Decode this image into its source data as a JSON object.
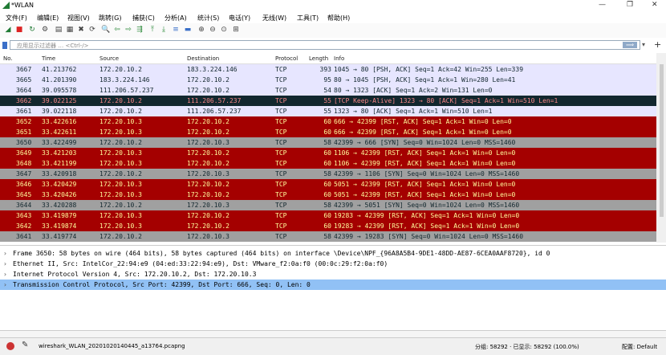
{
  "window": {
    "title": "*WLAN",
    "minimize": "—",
    "restore": "❐",
    "close": "✕"
  },
  "menu": [
    "文件(F)",
    "编辑(E)",
    "视图(V)",
    "跳转(G)",
    "捕获(C)",
    "分析(A)",
    "统计(S)",
    "电话(Y)",
    "无线(W)",
    "工具(T)",
    "帮助(H)"
  ],
  "toolbar": {
    "icons": [
      "shark-fin-icon",
      "stop-icon",
      "restart-icon",
      "options-icon",
      "open-icon",
      "save-icon",
      "close-file-icon",
      "reload-icon",
      "find-icon",
      "back-icon",
      "forward-icon",
      "goto-icon",
      "first-icon",
      "last-icon",
      "autoscroll-icon",
      "colorize-icon",
      "zoom-in-icon",
      "zoom-out-icon",
      "zoom-reset-icon",
      "resize-columns-icon"
    ],
    "glyphs": [
      "◢",
      "■",
      "↻",
      "⚙",
      "▤",
      "▦",
      "✖",
      "⟳",
      "🔍",
      "⇦",
      "⇨",
      "⇶",
      "⤒",
      "⤓",
      "≡",
      "▬",
      "⊕",
      "⊖",
      "⊙",
      "⊞"
    ]
  },
  "filter": {
    "placeholder": "应用显示过滤器 … <Ctrl-/>",
    "apply": "⟹",
    "dropdown": "▾",
    "add": "+"
  },
  "columns": [
    "No.",
    "Time",
    "Source",
    "Destination",
    "Protocol",
    "Length",
    "Info"
  ],
  "colors": {
    "selected_dark": "#12272e",
    "rst_red": "#a40000",
    "syn_gray": "#a0a0a0",
    "tcp_green": "#e7e6ff",
    "normal_purple": "#e7e6ff",
    "highlight_blue": "#91c1f5"
  },
  "packets": [
    {
      "no": "3667",
      "time": "41.213762",
      "src": "172.20.10.2",
      "dst": "183.3.224.146",
      "proto": "TCP",
      "len": "393",
      "info": "1045 → 80 [PSH, ACK] Seq=1 Ack=42 Win=255 Len=339",
      "style": "lavender"
    },
    {
      "no": "3665",
      "time": "41.201390",
      "src": "183.3.224.146",
      "dst": "172.20.10.2",
      "proto": "TCP",
      "len": "95",
      "info": "80 → 1045 [PSH, ACK] Seq=1 Ack=1 Win=280 Len=41",
      "style": "lavender"
    },
    {
      "no": "3664",
      "time": "39.095578",
      "src": "111.206.57.237",
      "dst": "172.20.10.2",
      "proto": "TCP",
      "len": "54",
      "info": "80 → 1323 [ACK] Seq=1 Ack=2 Win=131 Len=0",
      "style": "lavender"
    },
    {
      "no": "3662",
      "time": "39.022125",
      "src": "172.20.10.2",
      "dst": "111.206.57.237",
      "proto": "TCP",
      "len": "55",
      "info": "[TCP Keep-Alive] 1323 → 80 [ACK] Seq=1 Ack=1 Win=510 Len=1",
      "style": "dark"
    },
    {
      "no": "3661",
      "time": "39.022118",
      "src": "172.20.10.2",
      "dst": "111.206.57.237",
      "proto": "TCP",
      "len": "55",
      "info": "1323 → 80 [ACK] Seq=1 Ack=1 Win=510 Len=1",
      "style": "lavender"
    },
    {
      "no": "3652",
      "time": "33.422616",
      "src": "172.20.10.3",
      "dst": "172.20.10.2",
      "proto": "TCP",
      "len": "60",
      "info": "666 → 42399 [RST, ACK] Seq=1 Ack=1 Win=0 Len=0",
      "style": "red"
    },
    {
      "no": "3651",
      "time": "33.422611",
      "src": "172.20.10.3",
      "dst": "172.20.10.2",
      "proto": "TCP",
      "len": "60",
      "info": "666 → 42399 [RST, ACK] Seq=1 Ack=1 Win=0 Len=0",
      "style": "red"
    },
    {
      "no": "3650",
      "time": "33.422499",
      "src": "172.20.10.2",
      "dst": "172.20.10.3",
      "proto": "TCP",
      "len": "58",
      "info": "42399 → 666 [SYN] Seq=0 Win=1024 Len=0 MSS=1460",
      "style": "gray"
    },
    {
      "no": "3649",
      "time": "33.421203",
      "src": "172.20.10.3",
      "dst": "172.20.10.2",
      "proto": "TCP",
      "len": "60",
      "info": "1106 → 42399 [RST, ACK] Seq=1 Ack=1 Win=0 Len=0",
      "style": "red"
    },
    {
      "no": "3648",
      "time": "33.421199",
      "src": "172.20.10.3",
      "dst": "172.20.10.2",
      "proto": "TCP",
      "len": "60",
      "info": "1106 → 42399 [RST, ACK] Seq=1 Ack=1 Win=0 Len=0",
      "style": "red"
    },
    {
      "no": "3647",
      "time": "33.420918",
      "src": "172.20.10.2",
      "dst": "172.20.10.3",
      "proto": "TCP",
      "len": "58",
      "info": "42399 → 1106 [SYN] Seq=0 Win=1024 Len=0 MSS=1460",
      "style": "gray"
    },
    {
      "no": "3646",
      "time": "33.420429",
      "src": "172.20.10.3",
      "dst": "172.20.10.2",
      "proto": "TCP",
      "len": "60",
      "info": "5051 → 42399 [RST, ACK] Seq=1 Ack=1 Win=0 Len=0",
      "style": "red"
    },
    {
      "no": "3645",
      "time": "33.420426",
      "src": "172.20.10.3",
      "dst": "172.20.10.2",
      "proto": "TCP",
      "len": "60",
      "info": "5051 → 42399 [RST, ACK] Seq=1 Ack=1 Win=0 Len=0",
      "style": "red"
    },
    {
      "no": "3644",
      "time": "33.420288",
      "src": "172.20.10.2",
      "dst": "172.20.10.3",
      "proto": "TCP",
      "len": "58",
      "info": "42399 → 5051 [SYN] Seq=0 Win=1024 Len=0 MSS=1460",
      "style": "gray"
    },
    {
      "no": "3643",
      "time": "33.419879",
      "src": "172.20.10.3",
      "dst": "172.20.10.2",
      "proto": "TCP",
      "len": "60",
      "info": "19283 → 42399 [RST, ACK] Seq=1 Ack=1 Win=0 Len=0",
      "style": "red"
    },
    {
      "no": "3642",
      "time": "33.419874",
      "src": "172.20.10.3",
      "dst": "172.20.10.2",
      "proto": "TCP",
      "len": "60",
      "info": "19283 → 42399 [RST, ACK] Seq=1 Ack=1 Win=0 Len=0",
      "style": "red"
    },
    {
      "no": "3641",
      "time": "33.419774",
      "src": "172.20.10.2",
      "dst": "172.20.10.3",
      "proto": "TCP",
      "len": "58",
      "info": "42399 → 19283 [SYN] Seq=0 Win=1024 Len=0 MSS=1460",
      "style": "gray"
    }
  ],
  "details": [
    {
      "arrow": "›",
      "text": "Frame 3650: 58 bytes on wire (464 bits), 58 bytes captured (464 bits) on interface \\Device\\NPF_{96A8A5B4-9DE1-48DD-AE87-6CEA0AAF8720}, id 0",
      "selected": false
    },
    {
      "arrow": "›",
      "text": "Ethernet II, Src: IntelCor_22:94:e9 (04:ed:33:22:94:e9), Dst: VMware_f2:0a:f0 (00:0c:29:f2:0a:f0)",
      "selected": false
    },
    {
      "arrow": "›",
      "text": "Internet Protocol Version 4, Src: 172.20.10.2, Dst: 172.20.10.3",
      "selected": false
    },
    {
      "arrow": "›",
      "text": "Transmission Control Protocol, Src Port: 42399, Dst Port: 666, Seq: 0, Len: 0",
      "selected": true
    }
  ],
  "status": {
    "file": "wireshark_WLAN_20201020140445_a13764.pcapng",
    "packets": "分组: 58292 · 已显示: 58292 (100.0%)",
    "profile": "配置: Default"
  }
}
